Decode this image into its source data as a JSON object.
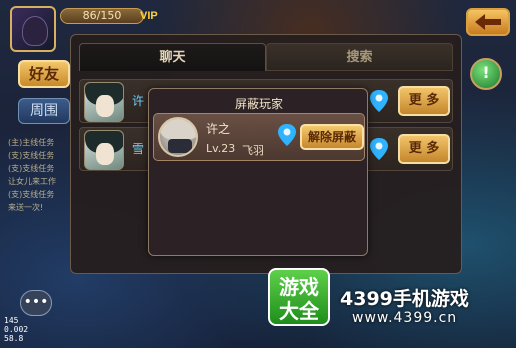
{
  "hud": {
    "hp_text": "86/150",
    "vip_text": "VIP"
  },
  "side_tabs": {
    "friends": "好友",
    "nearby": "周围"
  },
  "quests": [
    "(主)主线任务",
    "(支)支线任务",
    "(支)支线任务",
    "让女儿来工作",
    "(支)支线任务",
    "来送一次!"
  ],
  "debug": [
    "145",
    "0.002",
    "58.8"
  ],
  "panel": {
    "tabs": [
      {
        "label": "聊天",
        "active": true
      },
      {
        "label": "搜索",
        "active": false
      }
    ],
    "friends": [
      {
        "name": "许",
        "more_label": "更 多"
      },
      {
        "name": "雪",
        "more_label": "更 多"
      }
    ]
  },
  "blocked_dialog": {
    "title": "屏蔽玩家",
    "entry": {
      "name": "许之",
      "level": "Lv.23",
      "faction": "飞羽",
      "unblock_label": "解除屏蔽"
    }
  },
  "watermark": {
    "logo_line1": "游戏",
    "logo_line2": "大全",
    "site_name": "4399手机游戏",
    "url": "www.4399.cn"
  },
  "colors": {
    "accent_gold": "#f2c46a",
    "link_blue": "#6bd4ff",
    "panel_bg": "#261e1e"
  }
}
